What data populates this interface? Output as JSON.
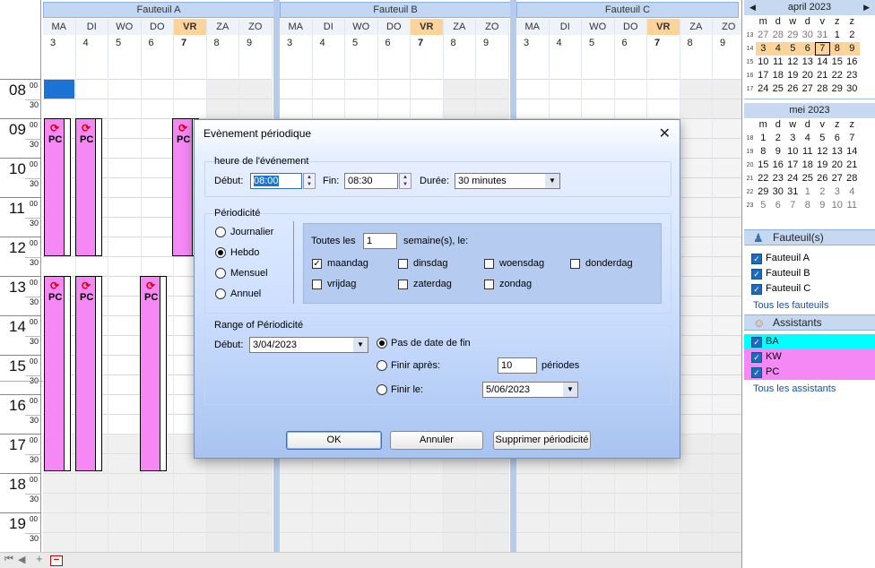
{
  "resources": [
    "Fauteuil A",
    "Fauteuil B",
    "Fauteuil C"
  ],
  "days": [
    {
      "name": "MA",
      "num": "3",
      "today": false
    },
    {
      "name": "DI",
      "num": "4",
      "today": false
    },
    {
      "name": "WO",
      "num": "5",
      "today": false
    },
    {
      "name": "DO",
      "num": "6",
      "today": false
    },
    {
      "name": "VR",
      "num": "7",
      "today": true
    },
    {
      "name": "ZA",
      "num": "8",
      "today": false
    },
    {
      "name": "ZO",
      "num": "9",
      "today": false
    }
  ],
  "hours": [
    "08",
    "09",
    "10",
    "11",
    "12",
    "13",
    "14",
    "15",
    "16",
    "17",
    "18",
    "19"
  ],
  "hour_min_top": "00",
  "hour_min_half": "30",
  "appointment_label": "PC",
  "appointment_icon": "recurrence-icon",
  "navbar": {
    "first": "⏮",
    "prev": "◀",
    "add": "+",
    "remove": "−"
  },
  "calendar": {
    "april": {
      "title": "april 2023",
      "days_header": [
        "m",
        "d",
        "w",
        "d",
        "v",
        "z",
        "z"
      ],
      "rows": [
        {
          "wk": "13",
          "days": [
            "27",
            "28",
            "29",
            "30",
            "31",
            "1",
            "2"
          ]
        },
        {
          "wk": "14",
          "days": [
            "3",
            "4",
            "5",
            "6",
            "7",
            "8",
            "9"
          ]
        },
        {
          "wk": "15",
          "days": [
            "10",
            "11",
            "12",
            "13",
            "14",
            "15",
            "16"
          ]
        },
        {
          "wk": "16",
          "days": [
            "17",
            "18",
            "19",
            "20",
            "21",
            "22",
            "23"
          ]
        },
        {
          "wk": "17",
          "days": [
            "24",
            "25",
            "26",
            "27",
            "28",
            "29",
            "30"
          ]
        }
      ]
    },
    "may": {
      "title": "mei 2023",
      "days_header": [
        "m",
        "d",
        "w",
        "d",
        "v",
        "z",
        "z"
      ],
      "rows": [
        {
          "wk": "18",
          "days": [
            "1",
            "2",
            "3",
            "4",
            "5",
            "6",
            "7"
          ]
        },
        {
          "wk": "19",
          "days": [
            "8",
            "9",
            "10",
            "11",
            "12",
            "13",
            "14"
          ]
        },
        {
          "wk": "20",
          "days": [
            "15",
            "16",
            "17",
            "18",
            "19",
            "20",
            "21"
          ]
        },
        {
          "wk": "21",
          "days": [
            "22",
            "23",
            "24",
            "25",
            "26",
            "27",
            "28"
          ]
        },
        {
          "wk": "22",
          "days": [
            "29",
            "30",
            "31",
            "1",
            "2",
            "3",
            "4"
          ]
        },
        {
          "wk": "23",
          "days": [
            "5",
            "6",
            "7",
            "8",
            "9",
            "10",
            "11"
          ]
        }
      ]
    }
  },
  "fauteuils": {
    "title": "Fauteuil(s)",
    "items": [
      "Fauteuil A",
      "Fauteuil B",
      "Fauteuil C"
    ],
    "all_link": "Tous les fauteuils"
  },
  "assistants": {
    "title": "Assistants",
    "items": [
      {
        "code": "BA",
        "color": "#00ffff"
      },
      {
        "code": "KW",
        "color": "#f588f5"
      },
      {
        "code": "PC",
        "color": "#f588f5"
      }
    ],
    "all_link": "Tous les assistants"
  },
  "dialog": {
    "title": "Evènement périodique",
    "time_group": "heure de l'événement",
    "start_label": "Début:",
    "start_value": "08:00",
    "end_label": "Fin:",
    "end_value": "08:30",
    "duration_label": "Durée:",
    "duration_value": "30 minutes",
    "period_group": "Périodicité",
    "period_options": [
      "Journalier",
      "Hebdo",
      "Mensuel",
      "Annuel"
    ],
    "period_selected": "Hebdo",
    "every_label": "Toutes les",
    "every_value": "1",
    "every_suffix": "semaine(s), le:",
    "weekdays": [
      {
        "label": "maandag",
        "checked": true
      },
      {
        "label": "dinsdag",
        "checked": false
      },
      {
        "label": "woensdag",
        "checked": false
      },
      {
        "label": "donderdag",
        "checked": false
      },
      {
        "label": "vrijdag",
        "checked": false
      },
      {
        "label": "zaterdag",
        "checked": false
      },
      {
        "label": "zondag",
        "checked": false
      }
    ],
    "range_group": "Range of Périodicité",
    "range_start_label": "Début:",
    "range_start_value": "3/04/2023",
    "no_end_label": "Pas de date de fin",
    "end_after_label": "Finir après:",
    "end_after_value": "10",
    "end_after_suffix": "périodes",
    "end_on_label": "Finir le:",
    "end_on_value": "5/06/2023",
    "ok": "OK",
    "cancel": "Annuler",
    "delete": "Supprimer périodicité",
    "close_icon": "close-icon"
  }
}
